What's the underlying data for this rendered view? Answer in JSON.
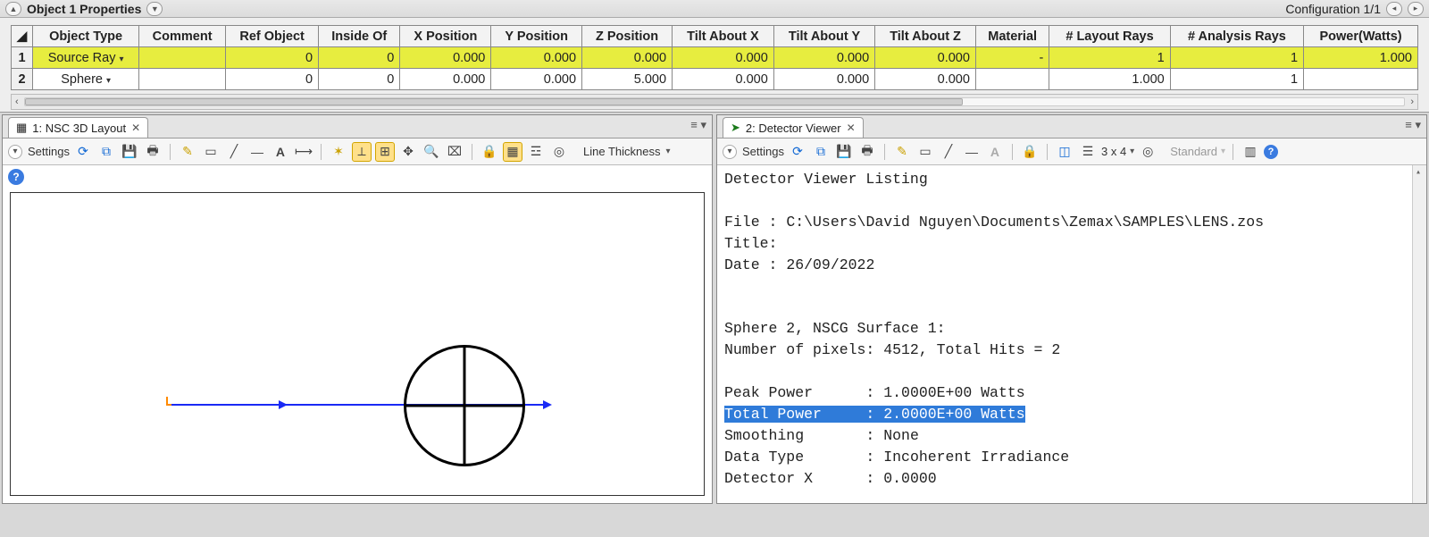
{
  "titlebar": {
    "title_left": "Object 1 Properties",
    "title_right": "Configuration 1/1"
  },
  "table": {
    "headers": [
      "",
      "Object Type",
      "Comment",
      "Ref Object",
      "Inside Of",
      "X Position",
      "Y Position",
      "Z Position",
      "Tilt About X",
      "Tilt About Y",
      "Tilt About Z",
      "Material",
      "# Layout Rays",
      "# Analysis Rays",
      "Power(Watts)"
    ],
    "rows": [
      {
        "n": "1",
        "type": "Source Ray",
        "comment": "",
        "ref": "0",
        "inside": "0",
        "x": "0.000",
        "y": "0.000",
        "z": "0.000",
        "tx": "0.000",
        "ty": "0.000",
        "tz": "0.000",
        "mat": "-",
        "layout": "1",
        "analysis": "1",
        "power": "1.000",
        "selected": true
      },
      {
        "n": "2",
        "type": "Sphere",
        "comment": "",
        "ref": "0",
        "inside": "0",
        "x": "0.000",
        "y": "0.000",
        "z": "5.000",
        "tx": "0.000",
        "ty": "0.000",
        "tz": "0.000",
        "mat": "",
        "layout": "1.000",
        "analysis": "1",
        "power": "",
        "selected": false
      }
    ]
  },
  "left_pane": {
    "tab_title": "1: NSC 3D Layout",
    "settings_label": "Settings",
    "line_thickness_label": "Line Thickness"
  },
  "right_pane": {
    "tab_title": "2: Detector Viewer",
    "settings_label": "Settings",
    "grid_label": "3 x 4",
    "mode_label": "Standard",
    "listing_title": "Detector Viewer Listing",
    "file_label": "File :",
    "file_path": "C:\\Users\\David Nguyen\\Documents\\Zemax\\SAMPLES\\LENS.zos",
    "title_label": "Title:",
    "date_label": "Date :",
    "date_value": "26/09/2022",
    "surface_line": "Sphere 2, NSCG Surface 1:",
    "pixels_line": "Number of pixels: 4512, Total Hits = 2",
    "peak_power_label": "Peak Power      :",
    "peak_power_value": "1.0000E+00 Watts",
    "total_power_label": "Total Power     :",
    "total_power_value": "2.0000E+00 Watts",
    "smoothing_label": "Smoothing       :",
    "smoothing_value": "None",
    "datatype_label": "Data Type       :",
    "datatype_value": "Incoherent Irradiance",
    "detx_label": "Detector X      :",
    "detx_value": "0.0000"
  }
}
